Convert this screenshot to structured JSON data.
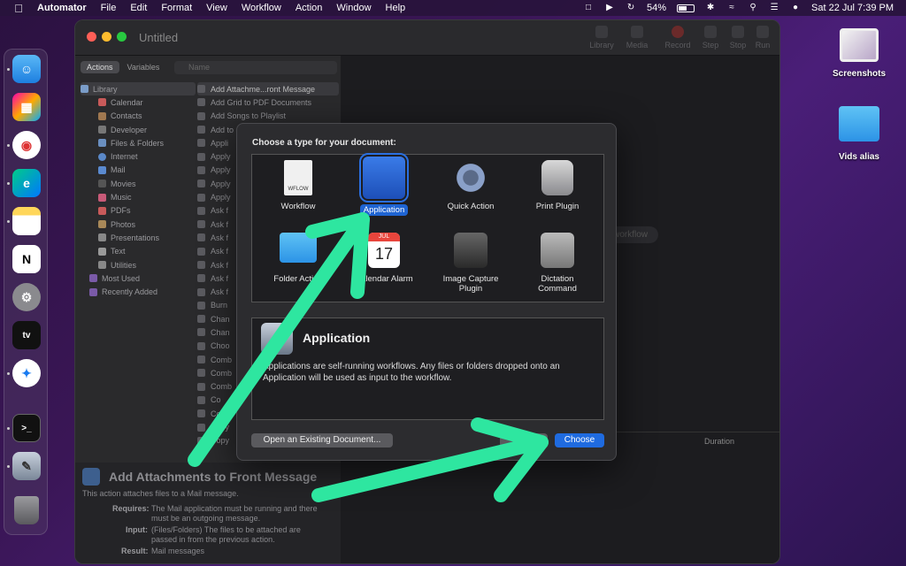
{
  "menubar": {
    "app_name": "Automator",
    "items": [
      "File",
      "Edit",
      "Format",
      "View",
      "Workflow",
      "Action",
      "Window",
      "Help"
    ],
    "battery": "54%",
    "battery_level": 0.54,
    "datetime": "Sat 22 Jul  7:39 PM"
  },
  "desktop": {
    "icons": [
      {
        "label": "Screenshots"
      },
      {
        "label": "Vids alias"
      }
    ]
  },
  "window": {
    "title": "Untitled",
    "toolbar": [
      "Library",
      "Media",
      "Record",
      "Step",
      "Stop",
      "Run"
    ],
    "tabs": [
      "Actions",
      "Variables"
    ],
    "search_placeholder": "Name",
    "library": [
      "Library",
      "Calendar",
      "Contacts",
      "Developer",
      "Files & Folders",
      "Internet",
      "Mail",
      "Movies",
      "Music",
      "PDFs",
      "Photos",
      "Presentations",
      "Text",
      "Utilities",
      "Most Used",
      "Recently Added"
    ],
    "actions": [
      "Add Attachme...ront Message",
      "Add Grid to PDF Documents",
      "Add Songs to Playlist",
      "Add to",
      "Appli",
      "Apply",
      "Apply",
      "Apply",
      "Apply",
      "Ask f",
      "Ask f",
      "Ask f",
      "Ask f",
      "Ask f",
      "Ask f",
      "Ask f",
      "Burn",
      "Chan",
      "Chan",
      "Choo",
      "Comb",
      "Comb",
      "Comb",
      "Co",
      "Cop",
      "Copy",
      "Copy"
    ],
    "desc_title": "Add Attachments to Front Message",
    "desc_text": "This action attaches files to a Mail message.",
    "requires_label": "Requires:",
    "requires_value_1": "The Mail application must be running and there",
    "requires_value_2": "must be an outgoing message.",
    "input_label": "Input:",
    "input_value_1": "(Files/Folders) The files to be attached are",
    "input_value_2": "passed in from the previous action.",
    "result_label": "Result:",
    "result_value": "Mail messages",
    "workflow_hint": "r workflow",
    "log_duration": "Duration"
  },
  "dialog": {
    "heading": "Choose a type for your document:",
    "types": [
      {
        "label": "Workflow",
        "badge": "WFLOW"
      },
      {
        "label": "Application"
      },
      {
        "label": "Quick Action"
      },
      {
        "label": "Print Plugin"
      },
      {
        "label": "Folder Action"
      },
      {
        "label": "Calendar Alarm",
        "cal_month": "JUL",
        "cal_day": "17"
      },
      {
        "label": "Image Capture\nPlugin"
      },
      {
        "label": "Dictation\nCommand"
      }
    ],
    "selected_title": "Application",
    "selected_desc": "Applications are self-running workflows. Any files or folders dropped onto an Application will be used as input to the workflow.",
    "open_existing": "Open an Existing Document...",
    "close": "Close",
    "choose": "Choose"
  },
  "colors": {
    "accent": "#1f6be0",
    "arrow": "#2ee6a0"
  }
}
